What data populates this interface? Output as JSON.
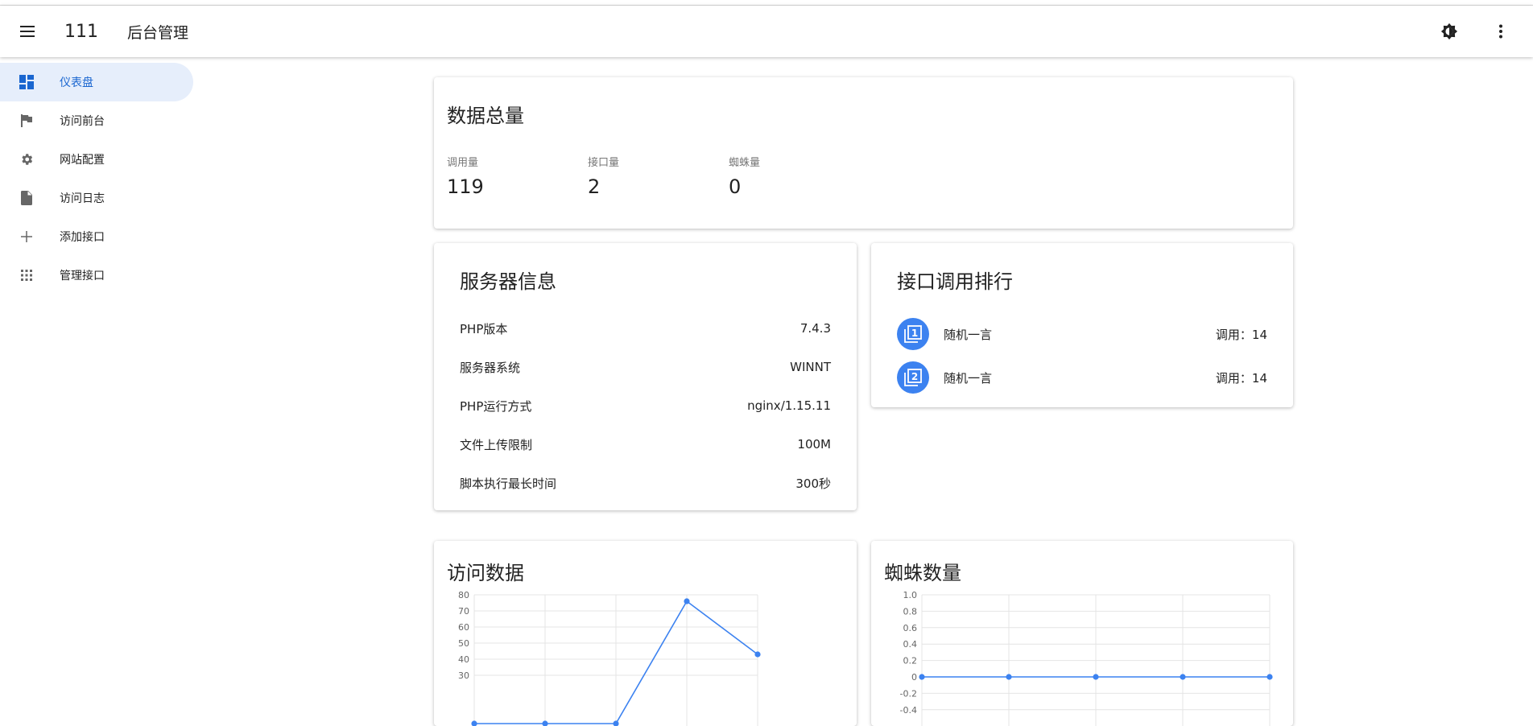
{
  "appbar": {
    "menu_icon": "menu-icon",
    "app_number": "111",
    "title": "后台管理",
    "theme_icon": "brightness-icon",
    "more_icon": "more-vertical-icon"
  },
  "sidebar": {
    "items": [
      {
        "label": "仪表盘",
        "icon": "dashboard-icon",
        "active": true
      },
      {
        "label": "访问前台",
        "icon": "flag-icon"
      },
      {
        "label": "网站配置",
        "icon": "gear-icon"
      },
      {
        "label": "访问日志",
        "icon": "file-icon"
      },
      {
        "label": "添加接口",
        "icon": "plus-icon"
      },
      {
        "label": "管理接口",
        "icon": "apps-grid-icon"
      }
    ]
  },
  "totals": {
    "title": "数据总量",
    "stats": [
      {
        "label": "调用量",
        "value": "119"
      },
      {
        "label": "接口量",
        "value": "2"
      },
      {
        "label": "蜘蛛量",
        "value": "0"
      }
    ]
  },
  "server": {
    "title": "服务器信息",
    "rows": [
      {
        "label": "PHP版本",
        "value": "7.4.3"
      },
      {
        "label": "服务器系统",
        "value": "WINNT"
      },
      {
        "label": "PHP运行方式",
        "value": "nginx/1.15.11"
      },
      {
        "label": "文件上传限制",
        "value": "100M"
      },
      {
        "label": "脚本执行最长时间",
        "value": "300秒"
      }
    ]
  },
  "ranking": {
    "title": "接口调用排行",
    "items": [
      {
        "rank": "1",
        "name": "随机一言",
        "count": "调用：14",
        "icon": "filter-1-icon"
      },
      {
        "rank": "2",
        "name": "随机一言",
        "count": "调用：14",
        "icon": "filter-2-icon"
      }
    ]
  },
  "visits": {
    "title": "访问数据"
  },
  "spiders": {
    "title": "蜘蛛数量"
  },
  "colors": {
    "accent": "#3c82f0",
    "active_bg": "#e6eefb"
  },
  "chart_data": [
    {
      "type": "line",
      "x": [
        0,
        1,
        2,
        3,
        4
      ],
      "series": [
        {
          "values": [
            0,
            0,
            0,
            76,
            43
          ]
        }
      ],
      "yticks": [
        "30",
        "40",
        "50",
        "60",
        "70",
        "80"
      ],
      "ylim": [
        0,
        80
      ],
      "grid": true
    },
    {
      "type": "line",
      "x": [
        0,
        1,
        2,
        3,
        4
      ],
      "series": [
        {
          "values": [
            0,
            0,
            0,
            0,
            0
          ]
        }
      ],
      "yticks": [
        "-0.4",
        "-0.2",
        "0",
        "0.2",
        "0.4",
        "0.6",
        "0.8",
        "1.0"
      ],
      "ylim": [
        -1,
        1
      ],
      "grid": true
    }
  ]
}
